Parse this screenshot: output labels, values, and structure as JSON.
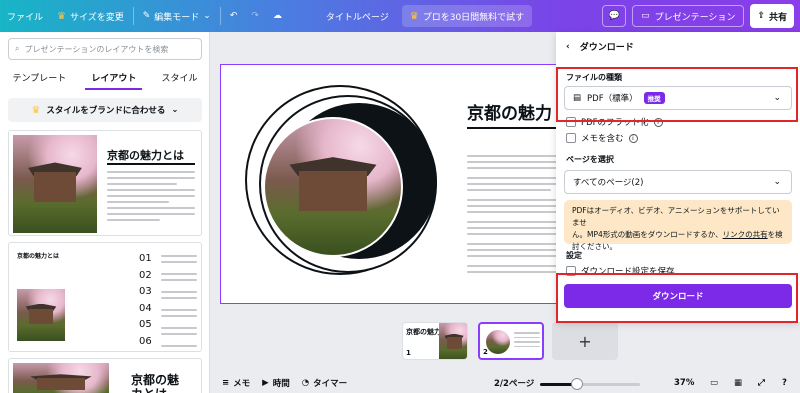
{
  "topbar": {
    "file": "ファイル",
    "resize": "サイズを変更",
    "edit_mode": "編集モード",
    "doc_title": "タイトルページ",
    "pro_trial": "プロを30日間無料で試す",
    "present": "プレゼンテーション",
    "share": "共有"
  },
  "left_panel": {
    "search_placeholder": "プレゼンテーションのレイアウトを検索",
    "tabs": [
      "テンプレート",
      "レイアウト",
      "スタイル"
    ],
    "brand_button": "スタイルをブランドに合わせる",
    "thumb1_title": "京都の魅力とは",
    "thumb2_title": "京都の魅力とは",
    "thumb2_numbers": [
      "01",
      "02",
      "03",
      "04",
      "05",
      "06"
    ],
    "thumb3_title": "京都の魅\nカとは"
  },
  "slide": {
    "title": "京都の魅力"
  },
  "pages": {
    "thumb1_title": "京都の魅力",
    "p1": "1",
    "p2": "2",
    "add": "+"
  },
  "bottombar": {
    "notes": "メモ",
    "timer_time": "時間",
    "timer": "タイマー",
    "page_count": "2/2ページ",
    "zoom": "37%",
    "zoom_level": 0.37
  },
  "download_panel": {
    "title": "ダウンロード",
    "file_type_label": "ファイルの種類",
    "file_type_value": "PDF（標準）",
    "recommended_badge": "推奨",
    "flatten_pdf": "PDFのフラット化",
    "include_notes": "メモを含む",
    "select_pages_label": "ページを選択",
    "pages_value": "すべてのページ(2)",
    "note_text_1": "PDFはオーディオ、ビデオ、アニメーションをサポートしていませ",
    "note_text_2": "ん。MP4形式の動画をダウンロードするか、",
    "note_link": "リンクの共有",
    "note_text_3": "を検",
    "note_text_4": "討ください。",
    "settings_label": "設定",
    "save_settings": "ダウンロード設定を保存",
    "download_button": "ダウンロード"
  },
  "colors": {
    "accent": "#7d2ae8",
    "highlight": "#e0262b",
    "note_bg": "#fde7c7"
  }
}
